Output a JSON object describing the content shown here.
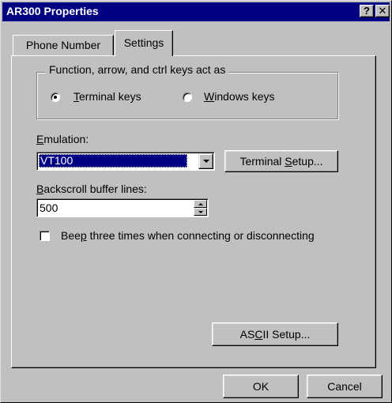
{
  "window": {
    "title": "AR300 Properties",
    "help_button": "?",
    "close_button": "✕"
  },
  "tabs": [
    {
      "label": "Phone Number",
      "selected": false
    },
    {
      "label": "Settings",
      "selected": true
    }
  ],
  "keys_group": {
    "title": "Function, arrow, and ctrl keys act as",
    "options": [
      {
        "label": "Terminal keys",
        "mnemonic": "T",
        "rest": "erminal keys",
        "selected": true
      },
      {
        "label": "Windows keys",
        "mnemonic": "W",
        "rest": "indows keys",
        "selected": false
      }
    ]
  },
  "emulation": {
    "label": "Emulation:",
    "label_mnemonic": "E",
    "label_rest": "mulation:",
    "value": "VT100"
  },
  "terminal_setup_button": {
    "label": "Terminal Setup...",
    "pre": "Terminal ",
    "mnemonic": "S",
    "post": "etup..."
  },
  "backscroll": {
    "label": "Backscroll buffer lines:",
    "label_mnemonic": "B",
    "label_rest": "ackscroll buffer lines:",
    "value": "500"
  },
  "beep_checkbox": {
    "label": "Beep three times when connecting or disconnecting",
    "pre": "Bee",
    "mnemonic": "p",
    "post": " three times when connecting or disconnecting",
    "checked": false
  },
  "ascii_setup_button": {
    "label": "ASCII Setup...",
    "pre": "AS",
    "mnemonic": "C",
    "post": "II Setup..."
  },
  "footer": {
    "ok_label": "OK",
    "cancel_label": "Cancel"
  },
  "colors": {
    "titlebar": "#000080",
    "face": "#c0c0c0",
    "selection": "#000080"
  }
}
